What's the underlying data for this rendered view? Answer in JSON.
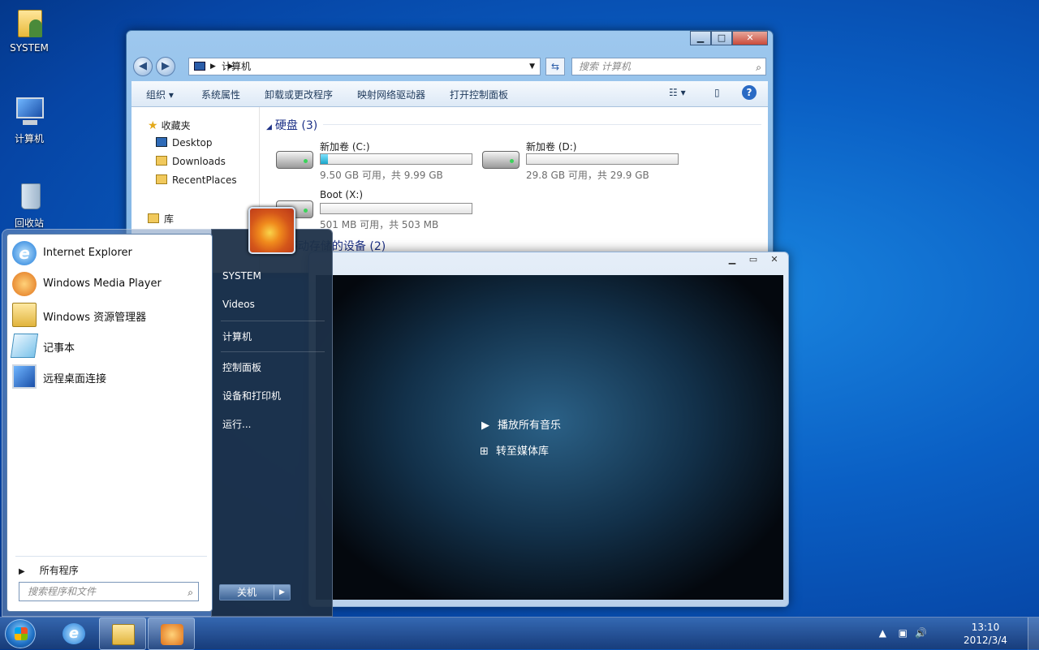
{
  "desktop": {
    "icons": [
      {
        "label": "SYSTEM",
        "icon": "user-folder-icon"
      },
      {
        "label": "计算机",
        "icon": "computer-icon"
      },
      {
        "label": "回收站",
        "icon": "recycle-bin-icon"
      }
    ]
  },
  "explorer": {
    "address": "计算机",
    "search_placeholder": "搜索 计算机",
    "toolbar": [
      "组织 ▾",
      "系统属性",
      "卸载或更改程序",
      "映射网络驱动器",
      "打开控制面板"
    ],
    "nav": {
      "favorites": "收藏夹",
      "items": [
        "Desktop",
        "Downloads",
        "RecentPlaces"
      ],
      "library": "库"
    },
    "groups": {
      "hard_disks": "硬盘 (3)",
      "removable": "可移动存储的设备 (2)"
    },
    "drives": [
      {
        "name": "新加卷 (C:)",
        "space": "9.50 GB 可用，共 9.99 GB",
        "used_fraction": 0.05
      },
      {
        "name": "新加卷 (D:)",
        "space": "29.8 GB 可用，共 29.9 GB",
        "used_fraction": 0.0
      },
      {
        "name": "Boot (X:)",
        "space": "501 MB 可用，共 503 MB",
        "used_fraction": 0.0
      }
    ]
  },
  "wmp": {
    "play_all": "播放所有音乐",
    "goto_library": "转至媒体库"
  },
  "start_menu": {
    "programs": [
      {
        "label": "Internet Explorer",
        "icon": "ie-icon"
      },
      {
        "label": "Windows Media Player",
        "icon": "media-player-icon"
      },
      {
        "label": "Windows 资源管理器",
        "icon": "explorer-folder-icon"
      },
      {
        "label": "记事本",
        "icon": "notepad-icon"
      },
      {
        "label": "远程桌面连接",
        "icon": "remote-desktop-icon"
      }
    ],
    "all_programs": "所有程序",
    "search_placeholder": "搜索程序和文件",
    "right_items": [
      "SYSTEM",
      "Videos",
      "计算机",
      "控制面板",
      "设备和打印机",
      "运行..."
    ],
    "shutdown": "关机"
  },
  "taskbar": {
    "time": "13:10",
    "date": "2012/3/4"
  },
  "colors": {
    "desktop": "#0a5fc4",
    "drive_fill": "#1aa6c9"
  }
}
